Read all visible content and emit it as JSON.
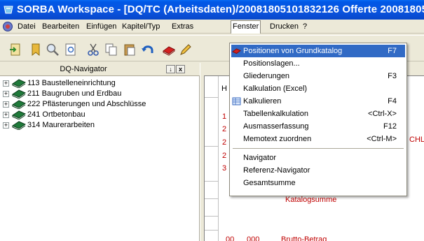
{
  "window": {
    "title": "SORBA Workspace - [DQ/TC (Arbeitsdaten)/20081805101832126 Offerte 20081805101",
    "accent": "#0a54e0"
  },
  "menubar": {
    "items": [
      {
        "label": "Datei"
      },
      {
        "label": "Bearbeiten"
      },
      {
        "label": "Einfügen"
      },
      {
        "label": "Kapitel/Typ"
      },
      {
        "label": "Extras"
      },
      {
        "label": "Fenster"
      },
      {
        "label": "Drucken"
      },
      {
        "label": "?"
      }
    ],
    "active": "Fenster"
  },
  "navigator": {
    "title": "DQ-Navigator",
    "pin_label": "↓",
    "close_label": "x",
    "items": [
      {
        "label": "113 Baustelleneinrichtung",
        "expander": "+"
      },
      {
        "label": "211 Baugruben und Erdbau",
        "expander": "+"
      },
      {
        "label": "222 Pflästerungen und Abschlüsse",
        "expander": "+"
      },
      {
        "label": "241 Ortbetonbau",
        "expander": "+"
      },
      {
        "label": "314 Maurerarbeiten",
        "expander": "+"
      }
    ]
  },
  "document": {
    "col_header": "H",
    "row_numbers": [
      "1",
      "2",
      "2",
      "2",
      "3"
    ],
    "right_fragment": "CHL",
    "katalogsumme": "Katalogsumme",
    "bottom_row": {
      "c1": "00",
      "c2": "000",
      "c3": "Brutto-Betrag"
    }
  },
  "fenster_menu": {
    "items": [
      {
        "label": "Positionen von Grundkatalog",
        "shortcut": "F7",
        "highlighted": true,
        "icon": "red-book-icon"
      },
      {
        "label": "Positionslagen...",
        "shortcut": ""
      },
      {
        "label": "Gliederungen",
        "shortcut": "F3"
      },
      {
        "label": "Kalkulation (Excel)",
        "shortcut": ""
      },
      {
        "label": "Kalkulieren",
        "shortcut": "F4",
        "icon": "table-icon"
      },
      {
        "label": "Tabellenkalkulation",
        "shortcut": "<Ctrl-X>"
      },
      {
        "label": "Ausmasserfassung",
        "shortcut": "F12"
      },
      {
        "label": "Memotext zuordnen",
        "shortcut": "<Ctrl-M>"
      },
      {
        "label": "Navigator",
        "shortcut": ""
      },
      {
        "label": "Referenz-Navigator",
        "shortcut": ""
      },
      {
        "label": "Gesamtsumme",
        "shortcut": ""
      }
    ]
  },
  "colors": {
    "highlight": "#316ac5",
    "doc_red": "#c00000",
    "menu_bg": "#ece9d8"
  }
}
